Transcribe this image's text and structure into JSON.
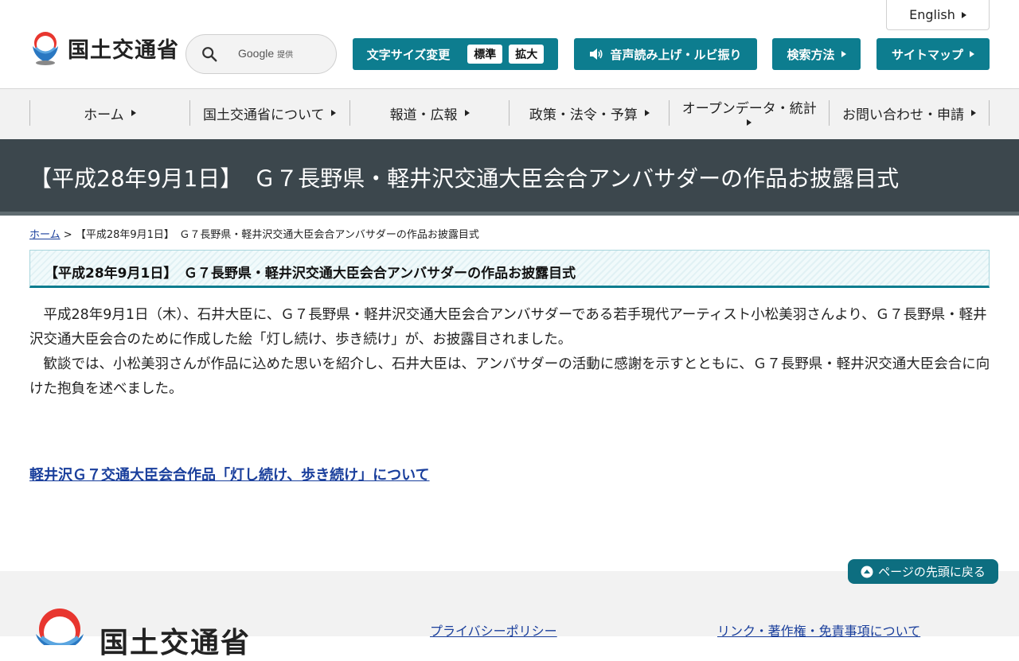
{
  "header": {
    "logo_text": "国土交通省",
    "search": {
      "placeholder": "",
      "google_label": "Google",
      "provided_label": "提供"
    },
    "font_size": {
      "label": "文字サイズ変更",
      "standard": "標準",
      "large": "拡大"
    },
    "voice_label": "音声読み上げ・ルビ振り",
    "search_method_label": "検索方法",
    "sitemap_label": "サイトマップ",
    "english_label": "English"
  },
  "nav": {
    "items": [
      {
        "label": "ホーム"
      },
      {
        "label": "国土交通省について"
      },
      {
        "label": "報道・広報"
      },
      {
        "label": "政策・法令・予算"
      },
      {
        "label": "オープンデータ・統計"
      },
      {
        "label": "お問い合わせ・申請"
      }
    ]
  },
  "page": {
    "title": "【平成28年9月1日】　Ｇ７長野県・軽井沢交通大臣会合アンバサダーの作品お披露目式",
    "breadcrumb_home": "ホーム",
    "breadcrumb_sep": ">",
    "breadcrumb_current": "【平成28年9月1日】　Ｇ７長野県・軽井沢交通大臣会合アンバサダーの作品お披露目式",
    "sub_heading": "【平成28年9月1日】　Ｇ７長野県・軽井沢交通大臣会合アンバサダーの作品お披露目式",
    "paragraph1": "平成28年9月1日（木）、石井大臣に、Ｇ７長野県・軽井沢交通大臣会合アンバサダーである若手現代アーティスト小松美羽さんより、Ｇ７長野県・軽井沢交通大臣会合のために作成した絵「灯し続け、歩き続け」が、お披露目されました。",
    "paragraph2": "歓談では、小松美羽さんが作品に込めた思いを紹介し、石井大臣は、アンバサダーの活動に感謝を示すとともに、Ｇ７長野県・軽井沢交通大臣会合に向けた抱負を述べました。",
    "doc_link": "軽井沢Ｇ７交通大臣会合作品「灯し続け、歩き続け」について"
  },
  "footer": {
    "page_top": "ページの先頭に戻る",
    "logo_text": "国土交通省",
    "privacy_link": "プライバシーポリシー",
    "links_link": "リンク・著作権・免責事項について"
  },
  "colors": {
    "teal": "#0d7d8f",
    "title_band": "#3c474d",
    "link": "#1a3f9c"
  }
}
